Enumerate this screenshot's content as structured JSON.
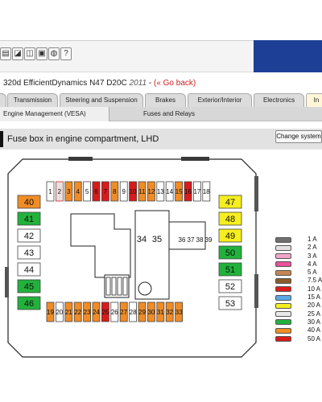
{
  "toolbar": {
    "icons": [
      "toolbar-icon-a",
      "toolbar-icon-b",
      "toolbar-icon-c",
      "toolbar-icon-d",
      "toolbar-icon-e",
      "help-icon"
    ]
  },
  "vehicle": {
    "model": "320d EfficientDynamics N47 D20C",
    "year": "2011",
    "separator": "-",
    "back_link": "(« Go back)"
  },
  "tabs": [
    {
      "label": ""
    },
    {
      "label": "Transmission"
    },
    {
      "label": "Steering and Suspension"
    },
    {
      "label": "Brakes"
    },
    {
      "label": "Exterior/Interior"
    },
    {
      "label": "Electronics"
    },
    {
      "label": "In"
    }
  ],
  "subtabs": [
    {
      "label": "Engine Management (VESA)"
    },
    {
      "label": "Fuses and Relays"
    }
  ],
  "page": {
    "title": "Fuse box in engine compartment, LHD",
    "change_button": "Change system"
  },
  "colors": {
    "accent": "#1d3f95",
    "back_link": "#cc2222"
  },
  "fuse_box": {
    "top_row": [
      {
        "label": "1",
        "rating": ""
      },
      {
        "label": "2",
        "rating": "2 A"
      },
      {
        "label": "3",
        "rating": "40 A"
      },
      {
        "label": "4",
        "rating": "40 A"
      },
      {
        "label": "5",
        "rating": ""
      },
      {
        "label": "6",
        "rating": "50 A"
      },
      {
        "label": "7",
        "rating": "50 A"
      },
      {
        "label": "8",
        "rating": "40 A"
      },
      {
        "label": "9",
        "rating": ""
      },
      {
        "label": "10",
        "rating": "50 A"
      },
      {
        "label": "11",
        "rating": "40 A"
      },
      {
        "label": "12",
        "rating": "40 A"
      },
      {
        "label": "13",
        "rating": ""
      },
      {
        "label": "14",
        "rating": ""
      },
      {
        "label": "15",
        "rating": "40 A"
      },
      {
        "label": "16",
        "rating": "50 A"
      },
      {
        "label": "17",
        "rating": ""
      },
      {
        "label": "18",
        "rating": ""
      }
    ],
    "bottom_row": [
      {
        "label": "19",
        "rating": "40 A"
      },
      {
        "label": "20",
        "rating": ""
      },
      {
        "label": "21",
        "rating": "40 A"
      },
      {
        "label": "22",
        "rating": "40 A"
      },
      {
        "label": "23",
        "rating": "40 A"
      },
      {
        "label": "24",
        "rating": "40 A"
      },
      {
        "label": "25",
        "rating": "50 A"
      },
      {
        "label": "26",
        "rating": ""
      },
      {
        "label": "27",
        "rating": "40 A"
      },
      {
        "label": "28",
        "rating": ""
      },
      {
        "label": "29",
        "rating": "40 A"
      },
      {
        "label": "30",
        "rating": "40 A"
      },
      {
        "label": "31",
        "rating": "40 A"
      },
      {
        "label": "32",
        "rating": "40 A"
      },
      {
        "label": "33",
        "rating": "40 A"
      }
    ],
    "left_col": [
      {
        "label": "40",
        "rating": "40 A"
      },
      {
        "label": "41",
        "rating": "30 A"
      },
      {
        "label": "42",
        "rating": ""
      },
      {
        "label": "43",
        "rating": ""
      },
      {
        "label": "44",
        "rating": ""
      },
      {
        "label": "45",
        "rating": "30 A"
      },
      {
        "label": "46",
        "rating": "30 A"
      }
    ],
    "right_col": [
      {
        "label": "47",
        "rating": "20 A"
      },
      {
        "label": "48",
        "rating": "20 A"
      },
      {
        "label": "49",
        "rating": "20 A"
      },
      {
        "label": "50",
        "rating": "30 A"
      },
      {
        "label": "51",
        "rating": "30 A"
      },
      {
        "label": "52",
        "rating": ""
      },
      {
        "label": "53",
        "rating": ""
      }
    ],
    "relay_labels": [
      "34",
      "35",
      "36",
      "37",
      "38",
      "39"
    ]
  },
  "legend": [
    {
      "label": "1 A",
      "color": "#6f6f6f"
    },
    {
      "label": "2 A",
      "color": "#e2e2e2"
    },
    {
      "label": "3 A",
      "color": "#f0a6c8"
    },
    {
      "label": "4 A",
      "color": "#e8529b"
    },
    {
      "label": "5 A",
      "color": "#c68552"
    },
    {
      "label": "7.5 A",
      "color": "#8b5a2b"
    },
    {
      "label": "10 A",
      "color": "#dd1b1b"
    },
    {
      "label": "15 A",
      "color": "#5aa8e6"
    },
    {
      "label": "20 A",
      "color": "#f6ee1f"
    },
    {
      "label": "25 A",
      "color": "#e9e9e9"
    },
    {
      "label": "30 A",
      "color": "#22b23c"
    },
    {
      "label": "40 A",
      "color": "#f08c26"
    },
    {
      "label": "50 A",
      "color": "#d81b1b"
    }
  ]
}
